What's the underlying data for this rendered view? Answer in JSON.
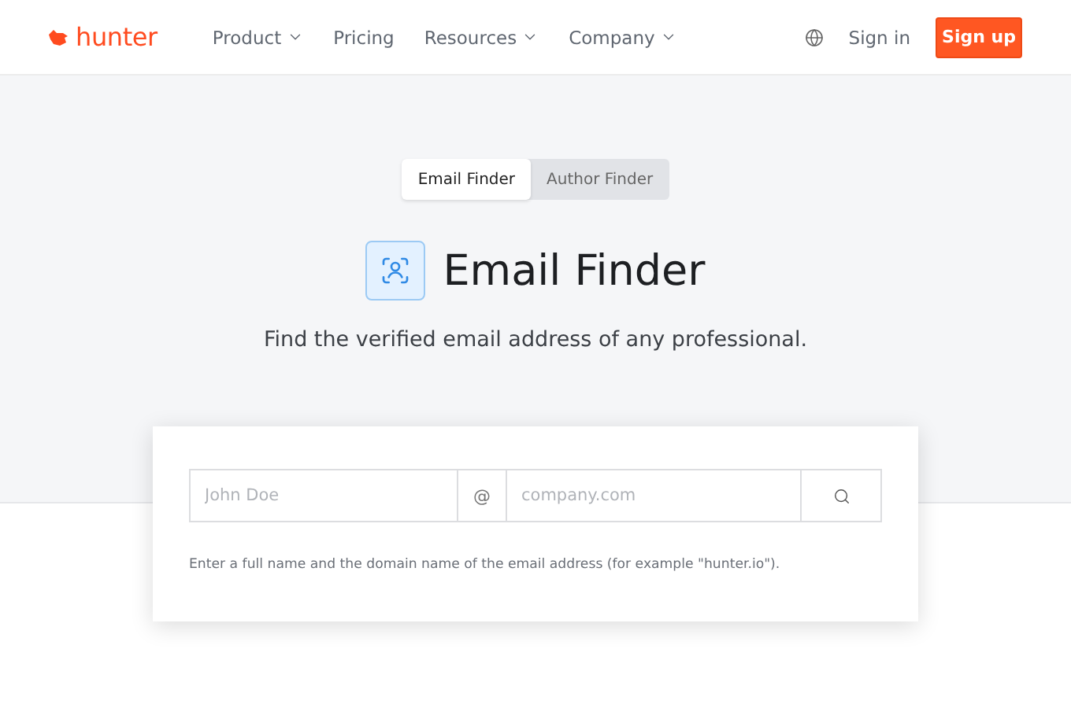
{
  "header": {
    "logo": "hunter",
    "nav": [
      {
        "label": "Product",
        "dropdown": true
      },
      {
        "label": "Pricing",
        "dropdown": false
      },
      {
        "label": "Resources",
        "dropdown": true
      },
      {
        "label": "Company",
        "dropdown": true
      }
    ],
    "sign_in": "Sign in",
    "sign_up": "Sign up"
  },
  "tabs": [
    {
      "label": "Email Finder",
      "selected": true
    },
    {
      "label": "Author Finder",
      "selected": false
    }
  ],
  "title": "Email Finder",
  "subtitle": "Find the verified email address of any professional.",
  "form": {
    "name_placeholder": "John Doe",
    "at": "@",
    "domain_placeholder": "company.com",
    "hint": "Enter a full name and the domain name of the email address (for example \"hunter.io\")."
  }
}
